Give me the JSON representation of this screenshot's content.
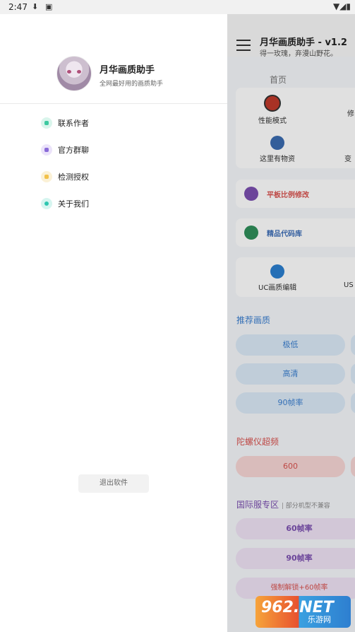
{
  "status_bar": {
    "time": "2:47"
  },
  "app": {
    "title": "月华画质助手 - v1.2",
    "subtitle": "得一玫瑰，弃漫山野花。",
    "tab": "首页",
    "features_row1": [
      "性能模式",
      "修"
    ],
    "features_row2": [
      "这里有物资",
      "变"
    ],
    "tablet_ratio": "平板比例修改",
    "code_library": "精品代码库",
    "features_row3": [
      "UC画质编辑",
      "US"
    ],
    "recommend_section": "推荐画质",
    "recommend_options": [
      "极低",
      "高清",
      "90帧率"
    ],
    "gyro_section": "陀螺仪超频",
    "gyro_option": "600",
    "intl_section": "国际服专区",
    "intl_note": "部分机型不兼容",
    "intl_options": [
      "60帧率",
      "90帧率",
      "强制解锁+60帧率"
    ]
  },
  "drawer": {
    "name": "月华画质助手",
    "tagline": "全网最好用的画质助手",
    "menu": [
      {
        "label": "联系作者",
        "icon": "person-icon",
        "color": "#3dc9a0"
      },
      {
        "label": "官方群聊",
        "icon": "group-icon",
        "color": "#8a6bd8"
      },
      {
        "label": "检测授权",
        "icon": "folder-icon",
        "color": "#f2c14a"
      },
      {
        "label": "关于我们",
        "icon": "drop-icon",
        "color": "#2ec6b0"
      }
    ],
    "exit_label": "退出软件"
  },
  "watermark": {
    "main": "962.NET",
    "sub": "乐游网"
  }
}
